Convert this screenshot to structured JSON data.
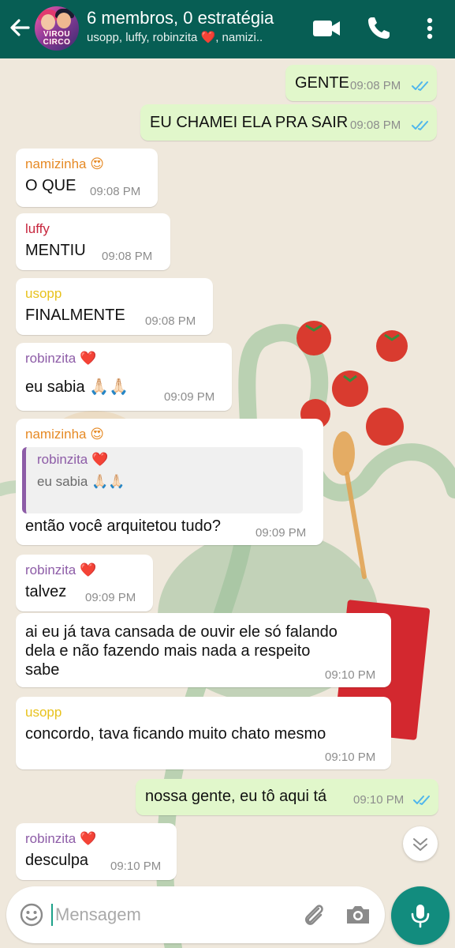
{
  "header": {
    "title": "6 membros, 0 estratégia",
    "subtitle": "usopp, luffy, robinzita ❤️, namizi..",
    "avatar_text": "VIROU CIRCO",
    "back_icon": "arrow-left-icon",
    "video_icon": "video-call-icon",
    "call_icon": "phone-icon",
    "menu_icon": "more-vertical-icon"
  },
  "colors": {
    "header": "#075e54",
    "outgoing_bubble": "#e1f7cb",
    "incoming_bubble": "#ffffff",
    "read_ticks": "#4fb6ec",
    "namizinha": "#e68a25",
    "luffy": "#c7263e",
    "usopp": "#e8c21d",
    "robinzita": "#8d5ca7",
    "mic_button": "#128c7e"
  },
  "messages": [
    {
      "direction": "out",
      "text": "GENTE",
      "time": "09:08 PM",
      "status": "read"
    },
    {
      "direction": "out",
      "text": "EU CHAMEI ELA PRA SAIR",
      "time": "09:08 PM",
      "status": "read"
    },
    {
      "direction": "in",
      "sender": "namizinha 😍",
      "text": "O QUE",
      "time": "09:08 PM"
    },
    {
      "direction": "in",
      "sender": "luffy",
      "text": "MENTIU",
      "time": "09:08 PM"
    },
    {
      "direction": "in",
      "sender": "usopp",
      "text": "FINALMENTE",
      "time": "09:08 PM"
    },
    {
      "direction": "in",
      "sender": "robinzita ❤️",
      "text": "eu sabia 🙏🏻🙏🏻",
      "time": "09:09 PM"
    },
    {
      "direction": "in",
      "sender": "namizinha 😍",
      "quote": {
        "author": "robinzita ❤️",
        "text": "eu sabia 🙏🏻🙏🏻"
      },
      "text": "então você arquitetou tudo?",
      "time": "09:09 PM"
    },
    {
      "direction": "in",
      "sender": "robinzita ❤️",
      "text": "talvez",
      "time": "09:09 PM"
    },
    {
      "direction": "in",
      "text_lines": [
        "ai eu já tava cansada de ouvir ele só falando",
        "dela e não fazendo mais nada a respeito",
        "sabe"
      ],
      "time": "09:10 PM"
    },
    {
      "direction": "in",
      "sender": "usopp",
      "text": "concordo, tava ficando muito chato mesmo",
      "time": "09:10 PM"
    },
    {
      "direction": "out",
      "text": "nossa gente, eu tô aqui tá",
      "time": "09:10 PM",
      "status": "read"
    },
    {
      "direction": "in",
      "sender": "robinzita ❤️",
      "text": "desculpa",
      "time": "09:10 PM"
    }
  ],
  "composer": {
    "placeholder": "Mensagem",
    "value": "",
    "emoji_icon": "emoji-icon",
    "attach_icon": "paperclip-icon",
    "camera_icon": "camera-icon",
    "mic_icon": "microphone-icon",
    "scroll_icon": "chevron-down-icon"
  }
}
